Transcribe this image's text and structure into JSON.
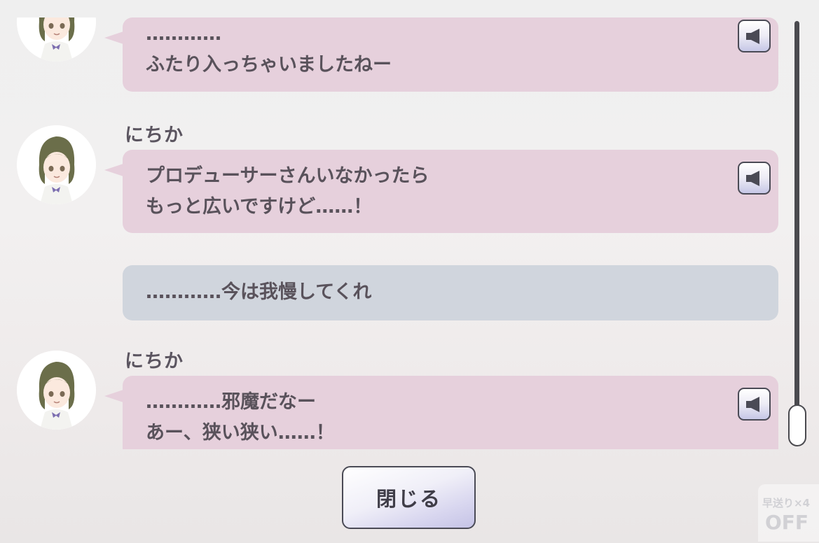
{
  "log": {
    "entries": [
      {
        "speaker": "",
        "lines": [
          "…………",
          "ふたり入っちゃいましたねー"
        ],
        "has_voice": true
      },
      {
        "speaker": "にちか",
        "lines": [
          "プロデューサーさんいなかったら",
          "もっと広いですけど……！"
        ],
        "has_voice": true
      },
      {
        "speaker": "",
        "lines": [
          "…………今は我慢してくれ"
        ],
        "has_voice": false
      },
      {
        "speaker": "にちか",
        "lines": [
          "…………邪魔だなー",
          "あー、狭い狭い……！"
        ],
        "has_voice": true
      }
    ]
  },
  "footer": {
    "close_label": "閉じる"
  },
  "fast_forward": {
    "label": "早送り×4",
    "state": "OFF"
  },
  "icons": {
    "voice": "speaker-icon",
    "avatar": "character-avatar"
  },
  "colors": {
    "character_bubble": "#e6d0dc",
    "player_bubble": "#d0d5dd",
    "text": "#59525b",
    "scrollbar": "#4a4a4f"
  }
}
